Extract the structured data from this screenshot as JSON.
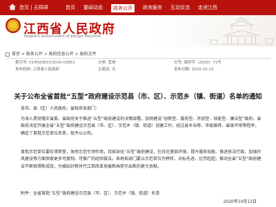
{
  "topbar": {
    "home_label": "首页 | 无障碍",
    "nav": [
      {
        "label": "首页",
        "active": false
      },
      {
        "label": "要闻动态",
        "active": false
      },
      {
        "label": "政务公开",
        "active": true
      },
      {
        "label": "政务服务",
        "active": false
      },
      {
        "label": "互动交流",
        "active": false
      },
      {
        "label": "走进江西",
        "active": false
      }
    ]
  },
  "header": {
    "title": "江西省人民政府",
    "subtitle": "People's Government of Jiangxi Province"
  },
  "breadcrumb": "首页 > 政务公开 > 政府信息公开 > 政府文件",
  "meta": {
    "index_no": "索引号: 014500815/2020-03851",
    "org": "发布机构: 江西省人民政府",
    "category": "分类: 其他",
    "topic": "主题词: 无",
    "doc_no": "文号: 赣府字〔2020〕71号",
    "title_label": "标题",
    "date_label": "发布日期: 2020-10-13"
  },
  "doc": {
    "title": "关于公布全省首批“五型”政府建设示范县（市、区）、示范乡（镇、街道）名单的通知",
    "para0": "各市、县（区）人民政府，省政府各部门：",
    "para1": "为深入贯彻落实省委、省政府关于推进“五型”政府建设的决策部署，加快建设“创新型、服务型、开放型、效能型、廉洁型”政府，省政府决定开展全省“五型”政府建设示范县（市、区）、示范乡（镇、街道）创建工作，经过县乡自荐、市级推荐、省级评审等程序，确定了首批示范单位名单，现予以公布。",
    "para2": "首批示范单位要珍惜荣誉，发挥示范引领作用，持续深化“五型”政府建设，在优化营商环境、提升服务效能、推进依法行政、加强作风建设等方面探索更多可复制、可推广的经验做法。各地各部门要以示范单位为榜样，对标先进、比学赶超，推动全省“五型”政府建设不断取得新成效，为描绘好新时代江西改革发展新画卷作出新的更大贡献。",
    "para3": "附件：全省首批“五型”政府建设示范县（市、区）、示范乡（镇、街道）名单",
    "date": "2020年10月13日"
  }
}
